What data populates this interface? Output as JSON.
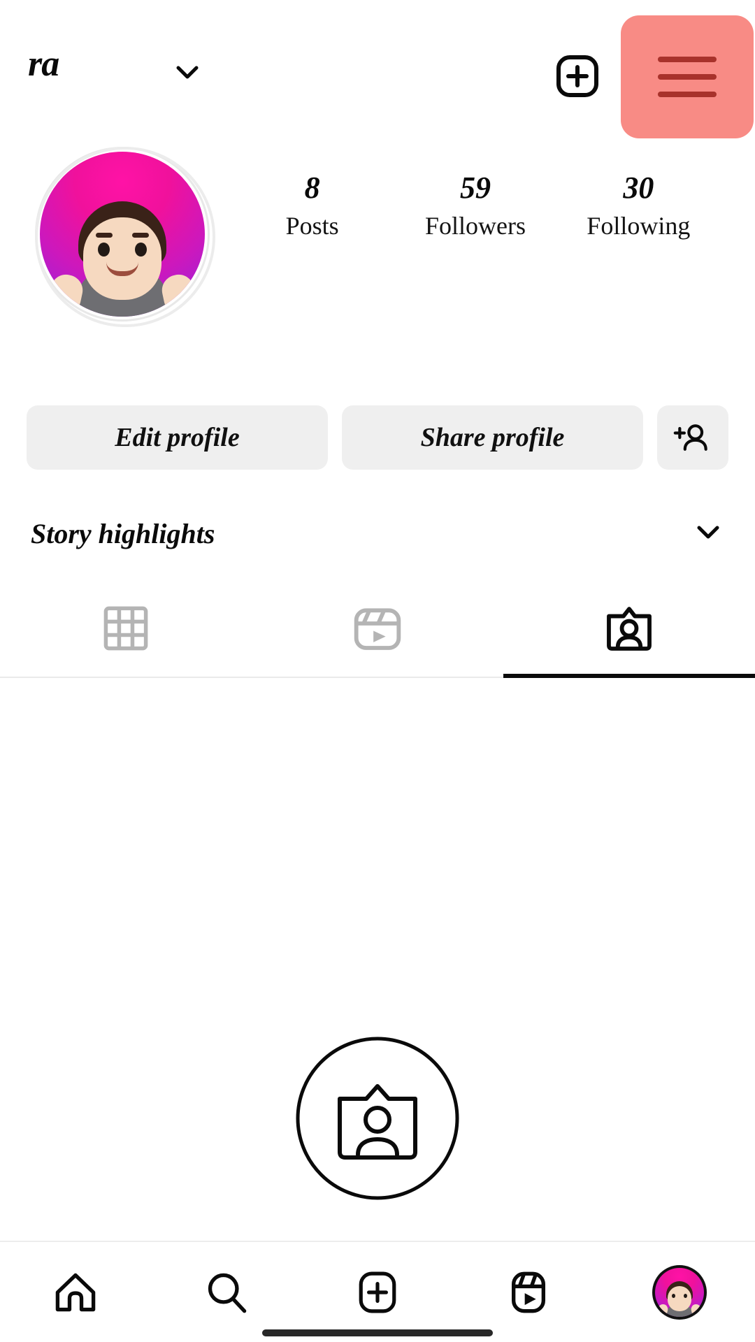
{
  "header": {
    "username": "ra",
    "username_full_truncated": "ra",
    "chevron_icon": "chevron-down-icon",
    "create_icon": "plus-square-icon",
    "menu_icon": "hamburger-menu-icon",
    "menu_highlight_color": "#F88B85",
    "menu_line_color": "#A8322B"
  },
  "profile": {
    "avatar_alt": "memoji-avatar",
    "stats": [
      {
        "value": "8",
        "label": "Posts"
      },
      {
        "value": "59",
        "label": "Followers"
      },
      {
        "value": "30",
        "label": "Following"
      }
    ]
  },
  "actions": {
    "edit_label": "Edit profile",
    "share_label": "Share profile",
    "add_person_icon": "add-person-icon"
  },
  "highlights": {
    "title": "Story highlights",
    "chevron_icon": "chevron-down-icon"
  },
  "tabs": [
    {
      "name": "grid",
      "icon": "grid-icon",
      "active": false
    },
    {
      "name": "reels",
      "icon": "reels-icon",
      "active": false
    },
    {
      "name": "tagged",
      "icon": "tagged-icon",
      "active": true
    }
  ],
  "empty_state": {
    "icon": "tagged-photos-empty-icon"
  },
  "bottom_nav": [
    {
      "name": "home",
      "icon": "home-icon"
    },
    {
      "name": "search",
      "icon": "search-icon"
    },
    {
      "name": "create",
      "icon": "plus-square-icon"
    },
    {
      "name": "reels",
      "icon": "reels-icon"
    },
    {
      "name": "profile",
      "icon": "profile-avatar-icon"
    }
  ],
  "colors": {
    "background": "#ffffff",
    "button_bg": "#efefef",
    "text": "#0a0a0a",
    "inactive_icon": "#b0b0b0",
    "divider": "#ededed"
  }
}
